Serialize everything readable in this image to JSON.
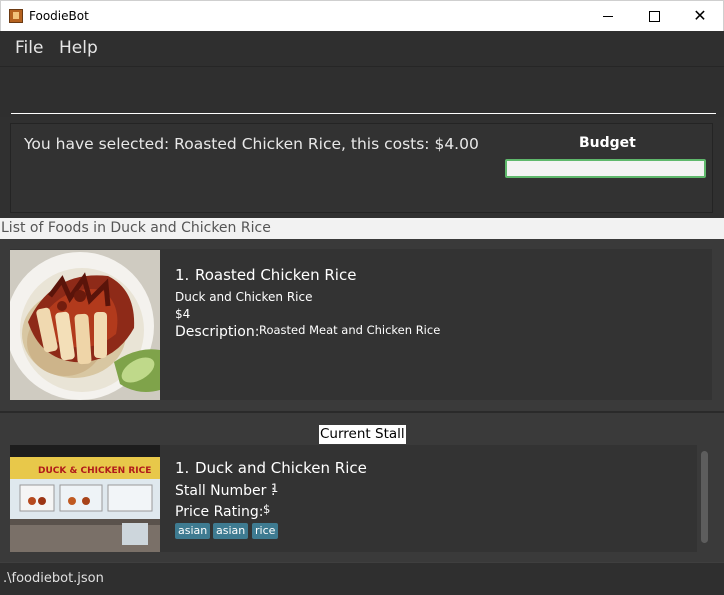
{
  "window": {
    "title": "FoodieBot",
    "controls": {
      "minimize": "minimize-icon",
      "maximize": "maximize-icon",
      "close": "close-icon"
    }
  },
  "menu": {
    "items": [
      "File",
      "Help"
    ]
  },
  "command": {
    "value": "",
    "placeholder": ""
  },
  "result": {
    "message": "You have selected: Roasted Chicken Rice, this costs: $4.00",
    "budget_label": "Budget",
    "budget_fraction": 0.0
  },
  "list": {
    "header": "List of Foods in Duck and Chicken Rice",
    "foods": [
      {
        "index": "1.",
        "name": "Roasted Chicken Rice",
        "stall": "Duck and Chicken Rice",
        "price": "$4",
        "description_label": "Description:",
        "description": "Roasted Meat and Chicken Rice"
      }
    ]
  },
  "current_stall": {
    "header": "Current Stall",
    "index": "1.",
    "name": "Duck and Chicken Rice",
    "stall_number_label": "Stall Number :",
    "stall_number": "1",
    "price_rating_label": "Price Rating:",
    "price_rating": "$",
    "tags": [
      "asian",
      "asian",
      "rice"
    ],
    "sign_text": "DUCK & CHICKEN RICE"
  },
  "status": {
    "file_path": ".\\foodiebot.json"
  },
  "colors": {
    "background": "#3c3c3c",
    "budget_border": "#5fb86c",
    "tag": "#3e7b91"
  }
}
